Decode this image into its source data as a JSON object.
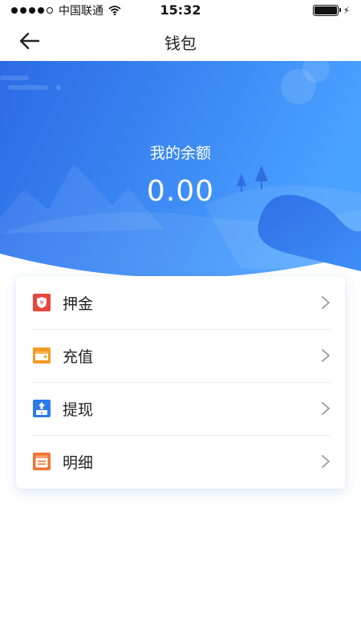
{
  "status_bar": {
    "carrier": "中国联通",
    "time": "15:32",
    "signal_icon": "signal-dots-icon",
    "wifi_icon": "wifi-icon",
    "battery_icon": "battery-icon",
    "charging_icon": "charging-bolt-icon"
  },
  "nav": {
    "title": "钱包",
    "back_icon": "back-arrow-icon"
  },
  "balance": {
    "label": "我的余额",
    "value": "0.00"
  },
  "menu": {
    "items": [
      {
        "label": "押金",
        "icon": "deposit-shield-icon",
        "color": "#e8453c"
      },
      {
        "label": "充值",
        "icon": "recharge-wallet-icon",
        "color": "#f59a23"
      },
      {
        "label": "提现",
        "icon": "withdraw-icon",
        "color": "#2f7bea"
      },
      {
        "label": "明细",
        "icon": "details-ledger-icon",
        "color": "#f0742f"
      }
    ]
  },
  "colors": {
    "hero_start": "#2d6fe8",
    "hero_end": "#4aa0ff",
    "chevron": "#9a9a9a"
  }
}
